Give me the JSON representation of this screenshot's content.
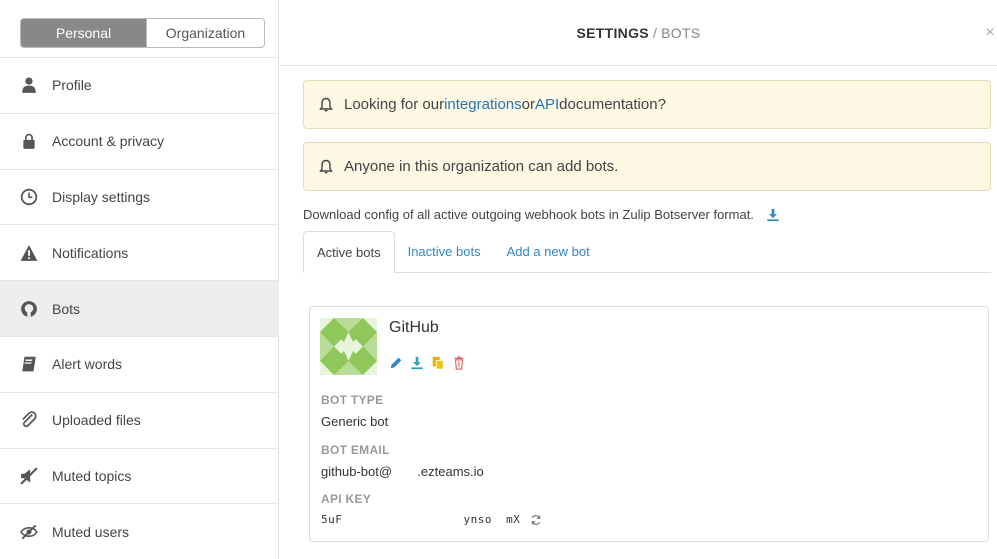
{
  "sidebar": {
    "toggle": {
      "personal": "Personal",
      "organization": "Organization"
    },
    "items": [
      {
        "label": "Profile",
        "icon": "user-icon"
      },
      {
        "label": "Account & privacy",
        "icon": "lock-icon"
      },
      {
        "label": "Display settings",
        "icon": "clock-icon"
      },
      {
        "label": "Notifications",
        "icon": "warning-icon"
      },
      {
        "label": "Bots",
        "icon": "github-icon"
      },
      {
        "label": "Alert words",
        "icon": "book-icon"
      },
      {
        "label": "Uploaded files",
        "icon": "paperclip-icon"
      },
      {
        "label": "Muted topics",
        "icon": "mute-icon"
      },
      {
        "label": "Muted users",
        "icon": "eye-slash-icon"
      }
    ],
    "active_index": 4
  },
  "header": {
    "title_strong": "SETTINGS",
    "title_sep": "/",
    "title_light": "BOTS",
    "close": "×"
  },
  "main": {
    "alert1": {
      "prefix": "Looking for our ",
      "link1": "integrations",
      "middle": " or ",
      "link2": "API",
      "suffix": " documentation?"
    },
    "alert2": {
      "text": "Anyone in this organization can add bots."
    },
    "download_text": "Download config of all active outgoing webhook bots in Zulip Botserver format.",
    "tabs": [
      "Active bots",
      "Inactive bots",
      "Add a new bot"
    ],
    "bot": {
      "name": "GitHub",
      "bot_type_label": "BOT TYPE",
      "bot_type": "Generic bot",
      "bot_email_label": "BOT EMAIL",
      "bot_email": "github-bot@       .ezteams.io",
      "api_key_label": "API KEY",
      "api_key": "5uF                 ynso  mX"
    }
  },
  "colors": {
    "accent": "#2f86c6",
    "alert_bg": "#fcf8e3",
    "avatar": "#8fc75a"
  }
}
